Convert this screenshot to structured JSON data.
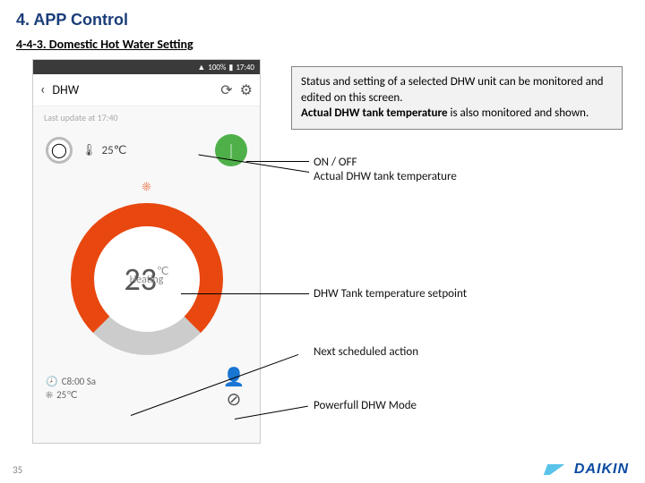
{
  "slide": {
    "title": "4. APP Control",
    "subtitle": "4-4-3. Domestic Hot Water Setting",
    "page_number": "35",
    "brand": "DAIKIN"
  },
  "phone": {
    "status": {
      "signal": "100%",
      "time": "17:40"
    },
    "appbar": {
      "title": "DHW"
    },
    "last_update": "Last update at 17:40",
    "outdoor_temp": "25℃",
    "setpoint_value": "23",
    "setpoint_unit": "℃",
    "setpoint_label": "Heating",
    "schedule_time": "C8:00 Sa",
    "schedule_temp": "25℃"
  },
  "annotations": {
    "box_line1": "Status and setting of a selected DHW unit can be monitored and edited on this screen.",
    "box_line2_bold": "Actual DHW tank temperature",
    "box_line2_rest": " is also monitored and shown.",
    "l1a": "ON / OFF",
    "l1b": "Actual DHW tank temperature",
    "l2": "DHW Tank temperature setpoint",
    "l3": "Next scheduled action",
    "l4": "Powerfull DHW Mode"
  }
}
